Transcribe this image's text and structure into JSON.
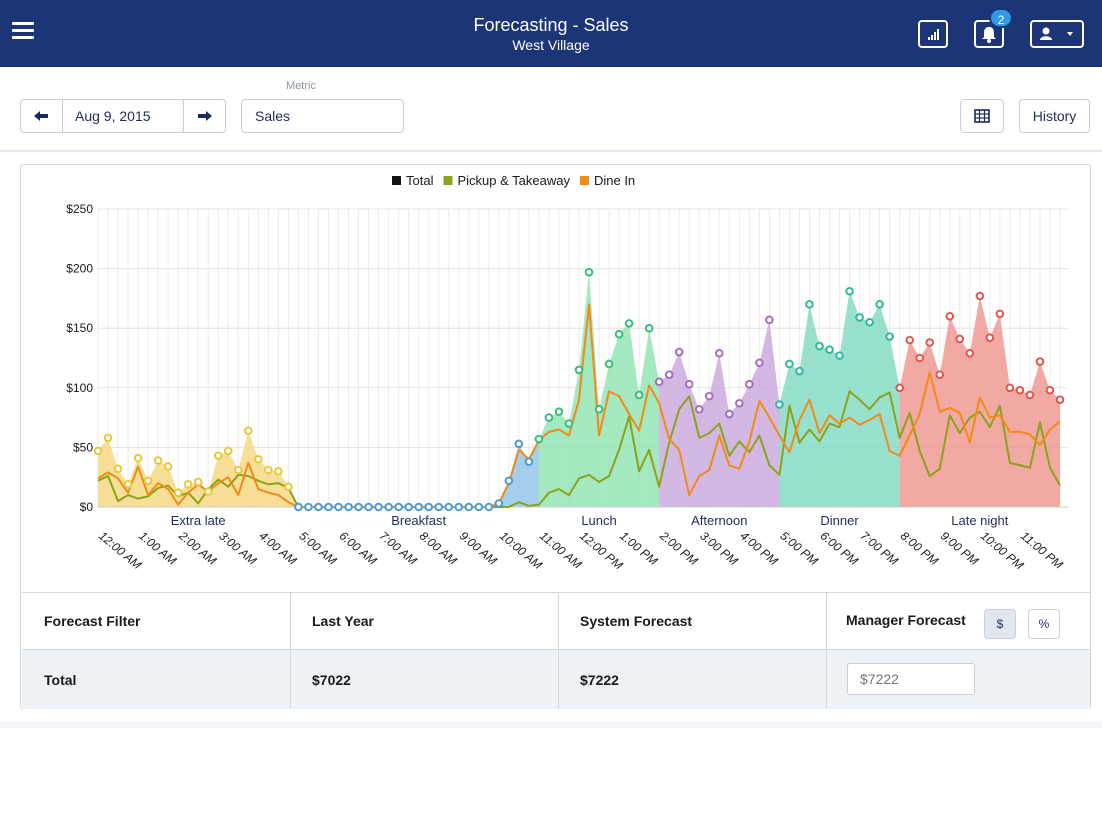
{
  "header": {
    "title": "Forecasting - Sales",
    "subtitle": "West Village",
    "notification_count": "2",
    "icons": [
      "menu-icon",
      "signal-icon",
      "bell-icon",
      "user-icon",
      "caret-down-icon"
    ]
  },
  "controls": {
    "date": "Aug 9, 2015",
    "metric_label": "Metric",
    "metric_value": "Sales",
    "history_label": "History"
  },
  "chart_data": {
    "type": "line",
    "legend": [
      {
        "name": "Total",
        "color": "#111111"
      },
      {
        "name": "Pickup & Takeaway",
        "color": "#8ba319"
      },
      {
        "name": "Dine In",
        "color": "#f28a17"
      }
    ],
    "ylim": [
      0,
      250
    ],
    "yticks": [
      "$0",
      "$50",
      "$100",
      "$150",
      "$200",
      "$250"
    ],
    "ytick_values": [
      0,
      50,
      100,
      150,
      200,
      250
    ],
    "x_tick_labels": [
      "12:00 AM",
      "1:00 AM",
      "2:00 AM",
      "3:00 AM",
      "4:00 AM",
      "5:00 AM",
      "6:00 AM",
      "7:00 AM",
      "8:00 AM",
      "9:00 AM",
      "10:00 AM",
      "11:00 AM",
      "12:00 PM",
      "1:00 PM",
      "2:00 PM",
      "3:00 PM",
      "4:00 PM",
      "5:00 PM",
      "6:00 PM",
      "7:00 PM",
      "8:00 PM",
      "9:00 PM",
      "10:00 PM",
      "11:00 PM"
    ],
    "points_per_hour": 4,
    "dayparts": [
      {
        "name": "Extra late",
        "start": 0,
        "end": 20,
        "color": "#f5d77e",
        "dot": "#e8c83a"
      },
      {
        "name": "Breakfast",
        "start": 20,
        "end": 44,
        "color": "#8fc3e8",
        "dot": "#4a9bd6"
      },
      {
        "name": "Lunch",
        "start": 44,
        "end": 56,
        "color": "#8fe3b2",
        "dot": "#35c07a"
      },
      {
        "name": "Afternoon",
        "start": 56,
        "end": 68,
        "color": "#c9a6dd",
        "dot": "#a26cc8"
      },
      {
        "name": "Dinner",
        "start": 68,
        "end": 80,
        "color": "#7ed9c2",
        "dot": "#2fb999"
      },
      {
        "name": "Late night",
        "start": 80,
        "end": 96,
        "color": "#f0938c",
        "dot": "#e2564c"
      }
    ],
    "total": [
      47,
      58,
      32,
      19,
      41,
      22,
      39,
      34,
      12,
      19,
      21,
      13,
      43,
      47,
      31,
      64,
      40,
      31,
      30,
      17,
      0,
      0,
      0,
      0,
      0,
      0,
      0,
      0,
      0,
      0,
      0,
      0,
      0,
      0,
      0,
      0,
      0,
      0,
      0,
      0,
      3,
      22,
      53,
      38,
      57,
      75,
      80,
      70,
      115,
      197,
      82,
      120,
      145,
      154,
      94,
      150,
      105,
      111,
      130,
      103,
      82,
      93,
      129,
      78,
      87,
      103,
      121,
      157,
      86,
      120,
      114,
      170,
      135,
      132,
      127,
      181,
      159,
      155,
      170,
      143,
      100,
      140,
      125,
      138,
      111,
      160,
      141,
      129,
      177,
      142,
      162,
      100,
      98,
      94,
      122,
      98,
      90
    ],
    "pickup_takeaway": [
      22,
      26,
      5,
      10,
      7,
      9,
      16,
      18,
      9,
      12,
      3,
      15,
      23,
      17,
      27,
      26,
      22,
      19,
      20,
      16,
      0,
      0,
      0,
      0,
      0,
      0,
      0,
      0,
      0,
      0,
      0,
      0,
      0,
      0,
      0,
      0,
      0,
      0,
      0,
      0,
      0,
      0,
      4,
      1,
      2,
      12,
      15,
      10,
      24,
      27,
      21,
      26,
      48,
      76,
      30,
      48,
      17,
      54,
      82,
      93,
      58,
      62,
      70,
      43,
      55,
      46,
      60,
      35,
      27,
      85,
      54,
      65,
      55,
      70,
      67,
      97,
      90,
      82,
      92,
      96,
      58,
      79,
      47,
      26,
      32,
      77,
      62,
      75,
      80,
      67,
      85,
      37,
      35,
      33,
      71,
      33,
      18
    ],
    "dine_in": [
      24,
      29,
      24,
      12,
      34,
      10,
      20,
      15,
      2,
      12,
      19,
      13,
      20,
      25,
      10,
      37,
      15,
      12,
      10,
      4,
      0,
      0,
      0,
      0,
      0,
      0,
      0,
      0,
      0,
      0,
      0,
      0,
      0,
      0,
      0,
      0,
      0,
      0,
      0,
      0,
      3,
      20,
      48,
      40,
      56,
      63,
      65,
      60,
      90,
      170,
      60,
      97,
      93,
      78,
      64,
      102,
      87,
      57,
      48,
      10,
      26,
      31,
      60,
      35,
      32,
      55,
      89,
      75,
      60,
      46,
      73,
      90,
      62,
      77,
      70,
      75,
      69,
      73,
      78,
      47,
      43,
      60,
      78,
      113,
      80,
      83,
      79,
      54,
      92,
      75,
      77,
      63,
      63,
      61,
      52,
      65,
      72
    ]
  },
  "table": {
    "headers": [
      "Forecast Filter",
      "Last Year",
      "System Forecast",
      "Manager Forecast"
    ],
    "toggle_dollar": "$",
    "toggle_percent": "%",
    "row_label": "Total",
    "last_year": "$7022",
    "system_forecast": "$7222",
    "manager_placeholder": "$7222"
  }
}
